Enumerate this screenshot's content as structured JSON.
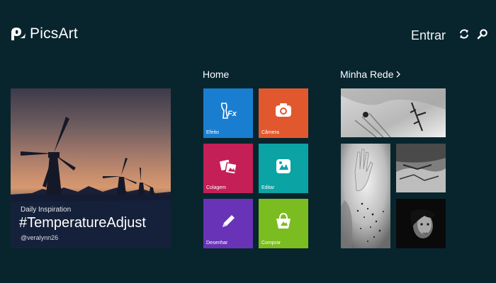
{
  "app": {
    "name": "PicsArt",
    "sign_in_label": "Entrar",
    "header_icons": [
      "refresh-icon",
      "search-icon"
    ]
  },
  "home": {
    "title": "Home",
    "tiles": [
      {
        "label": "Efeito",
        "icon": "effects-fx-icon",
        "color": "#1a7ed0"
      },
      {
        "label": "Câmera",
        "icon": "camera-icon",
        "color": "#e2582e"
      },
      {
        "label": "Colagem",
        "icon": "collage-icon",
        "color": "#c41f56"
      },
      {
        "label": "Editar",
        "icon": "edit-photo-icon",
        "color": "#0ba3a4"
      },
      {
        "label": "Desenhar",
        "icon": "pencil-icon",
        "color": "#6833b7"
      },
      {
        "label": "Comprar",
        "icon": "shopping-bag-icon",
        "color": "#7bbc20"
      }
    ]
  },
  "inspiration": {
    "kicker": "Daily Inspiration",
    "hashtag": "#TemperatureAdjust",
    "user": "@veralynn26"
  },
  "network": {
    "title": "Minha Rede",
    "chevron_icon": "chevron-right-icon"
  }
}
